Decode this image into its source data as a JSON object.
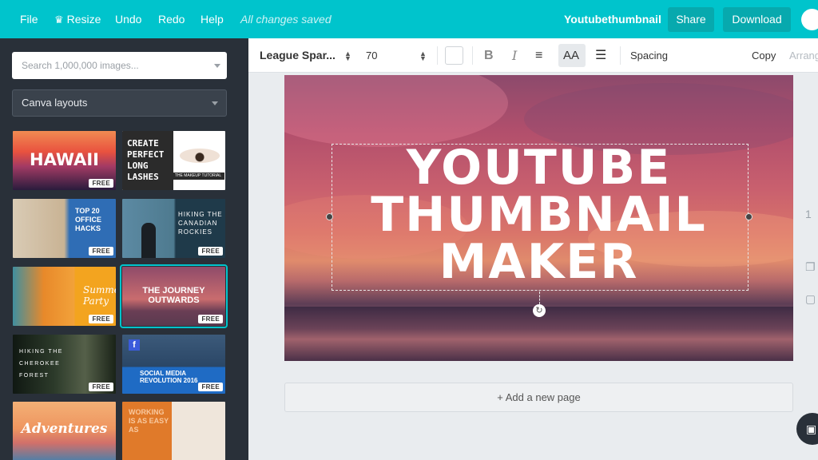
{
  "topbar": {
    "file": "File",
    "resize": "Resize",
    "undo": "Undo",
    "redo": "Redo",
    "help": "Help",
    "saved": "All changes saved",
    "doc_title": "Youtubethumbnail",
    "share": "Share",
    "download": "Download",
    "brand_color": "#00c4cc"
  },
  "sidebar": {
    "search_placeholder": "Search 1,000,000 images...",
    "layouts_select": "Canva layouts",
    "free_badge": "FREE",
    "thumbnails": [
      {
        "text": "HAWAII",
        "icon": "hawaii-sunset"
      },
      {
        "text": "CREATE PERFECT LONG LASHES",
        "sub": "THE MAKEUP TUTORIAL",
        "icon": "eye"
      },
      {
        "text": "TOP 20 OFFICE HACKS",
        "icon": "office-desk"
      },
      {
        "text": "HIKING THE CANADIAN ROCKIES",
        "icon": "mountain-lake"
      },
      {
        "text": "Summer Party",
        "icon": "oranges"
      },
      {
        "text": "THE JOURNEY OUTWARDS",
        "icon": "sunset-sea"
      },
      {
        "text": "HIKING THE CHEROKEE FOREST",
        "icon": "forest"
      },
      {
        "text": "SOCIAL MEDIA REVOLUTION 2016",
        "icon": "phone"
      },
      {
        "text": "Adventures",
        "icon": "sunset"
      },
      {
        "text": "WORKING IS AS EASY AS",
        "icon": "desk-items"
      }
    ]
  },
  "toolbar": {
    "font": "League Spar...",
    "size": "70",
    "bold": "B",
    "italic": "I",
    "aa": "AA",
    "spacing": "Spacing",
    "copy": "Copy",
    "arrange": "Arrang"
  },
  "canvas": {
    "line1": "YOUTUBE",
    "line2": "THUMBNAIL",
    "line3": "MAKER"
  },
  "add_page": "+ Add a new page"
}
